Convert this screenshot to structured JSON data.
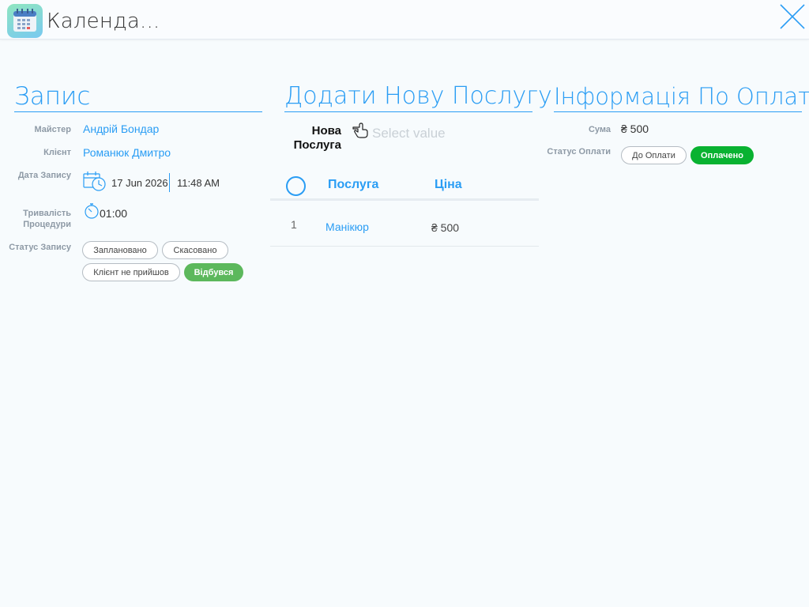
{
  "header": {
    "title": "Календа...",
    "app_icon": "calendar-icon",
    "close_icon": "close-icon"
  },
  "appointment": {
    "title": "Запис",
    "master_label": "Майстер",
    "master_value": "Андрій Бондар",
    "client_label": "Клієнт",
    "client_value": "Романюк Дмитро",
    "date_label": "Дата Запису",
    "date_value": "17 Jun 2026",
    "time_value": "11:48 AM",
    "duration_label_1": "Тривалість",
    "duration_label_2": "Процедури",
    "duration_value": "01:00",
    "status_label": "Статус Запису",
    "statuses": [
      "Заплановано",
      "Скасовано",
      "Клієнт не прийшов",
      "Відбувся"
    ],
    "active_status": "Відбувся"
  },
  "add_service": {
    "title": "Додати Нову Послугу",
    "new_label_1": "Нова",
    "new_label_2": "Послуга",
    "select_placeholder": "Select value",
    "columns": {
      "service": "Послуга",
      "price": "Ціна"
    },
    "rows": [
      {
        "num": "1",
        "service": "Манікюр",
        "price": "₴ 500"
      }
    ]
  },
  "payment": {
    "title": "Інформація По Оплаті",
    "sum_label": "Сума",
    "sum_value": "₴ 500",
    "status_label": "Статус Оплати",
    "statuses": [
      "До Оплати",
      "Оплачено"
    ],
    "active_status": "Оплачено"
  },
  "colors": {
    "accent": "#2a9df4",
    "success": "#5cb85c",
    "paid": "#09b231"
  }
}
